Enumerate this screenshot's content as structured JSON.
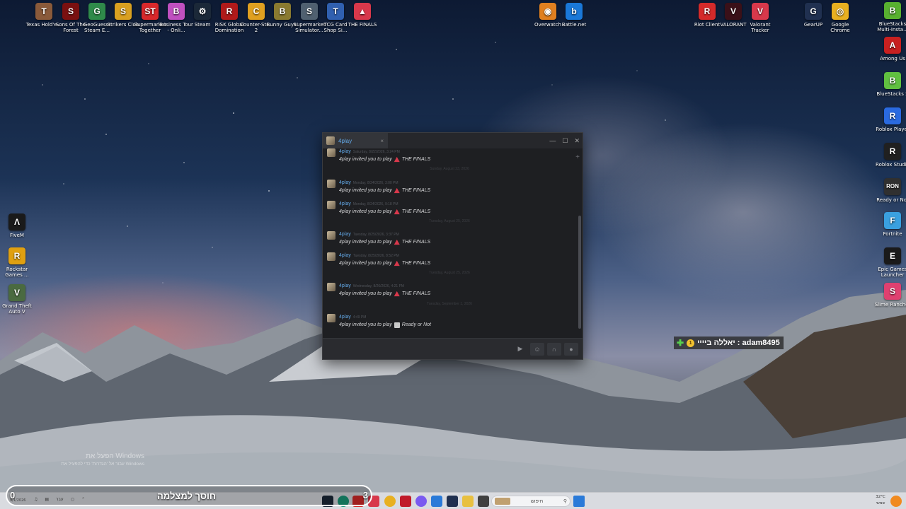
{
  "desktop": {
    "top_icons": [
      {
        "label": "Texas Hold'e...",
        "color": "#8a5a3a",
        "glyph": "T",
        "icon": "texas-holdem-icon"
      },
      {
        "label": "Sons Of The Forest",
        "color": "#7a1010",
        "glyph": "S",
        "icon": "sons-of-the-forest-icon"
      },
      {
        "label": "GeoGuessr Steam E...",
        "color": "#2f8a4a",
        "glyph": "G",
        "icon": "geoguessr-icon"
      },
      {
        "label": "Strikers Club",
        "color": "#d9a020",
        "glyph": "S",
        "icon": "strikers-club-icon"
      },
      {
        "label": "Supermarket Together",
        "color": "#d8282b",
        "glyph": "ST",
        "icon": "supermarket-together-icon"
      },
      {
        "label": "Business Tour - Onli...",
        "color": "#c050c0",
        "glyph": "B",
        "icon": "business-tour-icon"
      },
      {
        "label": "Steam",
        "color": "#1b2838",
        "glyph": "⚙",
        "icon": "steam-icon"
      },
      {
        "label": "RISK Global Domination",
        "color": "#b01a1a",
        "glyph": "R",
        "icon": "risk-icon"
      },
      {
        "label": "Counter-Str... 2",
        "color": "#e0a020",
        "glyph": "C",
        "icon": "counter-strike-icon"
      },
      {
        "label": "Bunny Guys!",
        "color": "#8a7a30",
        "glyph": "B",
        "icon": "bunny-guys-icon"
      },
      {
        "label": "Supermarket Simulator...",
        "color": "#506070",
        "glyph": "S",
        "icon": "supermarket-simulator-icon"
      },
      {
        "label": "TCG Card Shop Si...",
        "color": "#3060b0",
        "glyph": "T",
        "icon": "tcg-card-shop-icon"
      },
      {
        "label": "THE FINALS",
        "color": "#d8384b",
        "glyph": "▲",
        "icon": "the-finals-icon"
      },
      {
        "label": "Overwatch",
        "color": "#e08020",
        "glyph": "◉",
        "icon": "overwatch-icon"
      },
      {
        "label": "Battle.net",
        "color": "#1a78d8",
        "glyph": "b",
        "icon": "battlenet-icon"
      },
      {
        "label": "Riot Client",
        "color": "#d42a2a",
        "glyph": "R",
        "icon": "riot-client-icon"
      },
      {
        "label": "VALORANT",
        "color": "#3a1018",
        "glyph": "V",
        "icon": "valorant-icon"
      },
      {
        "label": "Valorant Tracker",
        "color": "#d8384b",
        "glyph": "V",
        "icon": "valorant-tracker-icon"
      },
      {
        "label": "GearUP",
        "color": "#203050",
        "glyph": "G",
        "icon": "gearup-icon"
      },
      {
        "label": "Google Chrome",
        "color": "#e8b020",
        "glyph": "◎",
        "icon": "chrome-icon"
      }
    ],
    "right_icons": [
      {
        "label": "BlueStacks Multi-Insta...",
        "color": "#58b030",
        "glyph": "B",
        "icon": "bluestacks-multi-icon"
      },
      {
        "label": "Among Us",
        "color": "#c82020",
        "glyph": "A",
        "icon": "among-us-icon"
      },
      {
        "label": "BlueStacks 5",
        "color": "#60c040",
        "glyph": "B",
        "icon": "bluestacks-icon"
      },
      {
        "label": "Roblox Player",
        "color": "#2a6ae0",
        "glyph": "R",
        "icon": "roblox-player-icon"
      },
      {
        "label": "Roblox Studio",
        "color": "#202020",
        "glyph": "R",
        "icon": "roblox-studio-icon"
      },
      {
        "label": "Ready or Not",
        "color": "#303030",
        "glyph": "RON",
        "icon": "ready-or-not-icon"
      },
      {
        "label": "Fortnite",
        "color": "#3aa0e0",
        "glyph": "F",
        "icon": "fortnite-icon"
      },
      {
        "label": "Epic Games Launcher",
        "color": "#1a1a1a",
        "glyph": "E",
        "icon": "epic-games-icon"
      },
      {
        "label": "Slime Rancher",
        "color": "#e04070",
        "glyph": "S",
        "icon": "slime-rancher-icon"
      }
    ],
    "left_icons": [
      {
        "label": "FiveM",
        "color": "#1a1a1a",
        "glyph": "Λ",
        "icon": "fivem-icon"
      },
      {
        "label": "Rockstar Games ...",
        "color": "#e0a010",
        "glyph": "R",
        "icon": "rockstar-icon"
      },
      {
        "label": "Grand Theft Auto V",
        "color": "#4a6a40",
        "glyph": "V",
        "icon": "gta-v-icon"
      }
    ]
  },
  "chat": {
    "tab_name": "4play",
    "tab_close": "×",
    "win_minimize": "—",
    "win_maximize": "☐",
    "win_close": "✕",
    "add_friend": "+",
    "messages": [
      {
        "sender": "4play",
        "time": "Saturday, 8/22/2026, 3:24 PM",
        "text": "4play invited you to play",
        "game": "THE FINALS",
        "game_icon": "the-finals-icon"
      },
      {
        "sender": "4play",
        "time": "Monday, 8/24/2026, 3:00 PM",
        "text": "4play invited you to play",
        "game": "THE FINALS",
        "game_icon": "the-finals-icon"
      },
      {
        "sender": "4play",
        "time": "Monday, 8/24/2026, 9:18 PM",
        "text": "4play invited you to play",
        "game": "THE FINALS",
        "game_icon": "the-finals-icon"
      },
      {
        "sender": "4play",
        "time": "Tuesday, 8/25/2026, 3:37 PM",
        "text": "4play invited you to play",
        "game": "THE FINALS",
        "game_icon": "the-finals-icon"
      },
      {
        "sender": "4play",
        "time": "Tuesday, 8/25/2026, 8:52 PM",
        "text": "4play invited you to play",
        "game": "THE FINALS",
        "game_icon": "the-finals-icon"
      },
      {
        "sender": "4play",
        "time": "Wednesday, 8/26/2026, 4:21 PM",
        "text": "4play invited you to play",
        "game": "THE FINALS",
        "game_icon": "the-finals-icon"
      },
      {
        "sender": "4play",
        "time": "4:49 PM",
        "text": "4play invited you to play",
        "game": "Ready or Not",
        "game_icon": "ready-or-not-icon"
      }
    ],
    "dividers": [
      "Sunday, August 23, 2026",
      "Tuesday, August 25, 2026",
      "Tuesday, August 25, 2026",
      "Tuesday, September 1, 2026"
    ]
  },
  "overlay_tag": {
    "text": "יאללה ביייי : adam8495",
    "coin": "1",
    "plus": "✚"
  },
  "watermark": {
    "line1": "הפעל את Windows",
    "line2": "עבור אל 'הגדרות' כדי להפעיל את Windows"
  },
  "taskbar": {
    "search_placeholder": "חיפוש",
    "search_icon": "search-icon",
    "temperature": "32°C",
    "weather_text": "שמשי",
    "left_date": "9/1/2026",
    "left_lang": "עבר"
  },
  "recording": {
    "text": "חוסך למצלמה",
    "count_left": "0",
    "count_right": "3"
  }
}
